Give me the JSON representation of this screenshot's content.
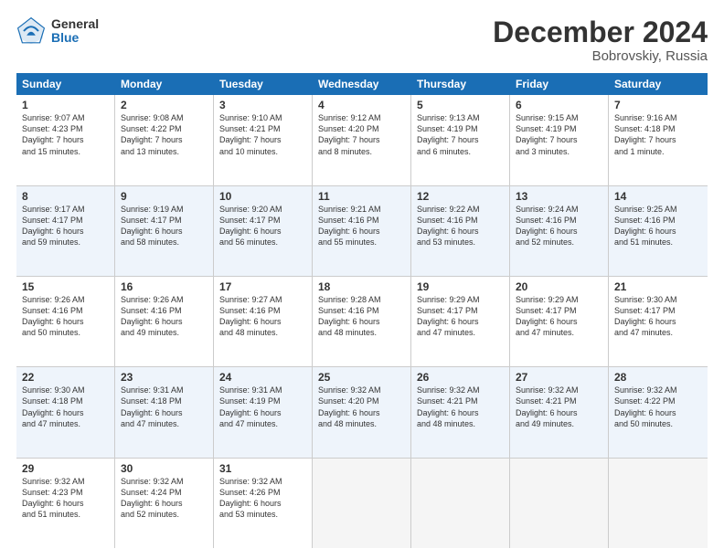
{
  "logo": {
    "general": "General",
    "blue": "Blue"
  },
  "title": "December 2024",
  "location": "Bobrovskiy, Russia",
  "days_of_week": [
    "Sunday",
    "Monday",
    "Tuesday",
    "Wednesday",
    "Thursday",
    "Friday",
    "Saturday"
  ],
  "weeks": [
    [
      {
        "day": "1",
        "info": "Sunrise: 9:07 AM\nSunset: 4:23 PM\nDaylight: 7 hours\nand 15 minutes."
      },
      {
        "day": "2",
        "info": "Sunrise: 9:08 AM\nSunset: 4:22 PM\nDaylight: 7 hours\nand 13 minutes."
      },
      {
        "day": "3",
        "info": "Sunrise: 9:10 AM\nSunset: 4:21 PM\nDaylight: 7 hours\nand 10 minutes."
      },
      {
        "day": "4",
        "info": "Sunrise: 9:12 AM\nSunset: 4:20 PM\nDaylight: 7 hours\nand 8 minutes."
      },
      {
        "day": "5",
        "info": "Sunrise: 9:13 AM\nSunset: 4:19 PM\nDaylight: 7 hours\nand 6 minutes."
      },
      {
        "day": "6",
        "info": "Sunrise: 9:15 AM\nSunset: 4:19 PM\nDaylight: 7 hours\nand 3 minutes."
      },
      {
        "day": "7",
        "info": "Sunrise: 9:16 AM\nSunset: 4:18 PM\nDaylight: 7 hours\nand 1 minute."
      }
    ],
    [
      {
        "day": "8",
        "info": "Sunrise: 9:17 AM\nSunset: 4:17 PM\nDaylight: 6 hours\nand 59 minutes."
      },
      {
        "day": "9",
        "info": "Sunrise: 9:19 AM\nSunset: 4:17 PM\nDaylight: 6 hours\nand 58 minutes."
      },
      {
        "day": "10",
        "info": "Sunrise: 9:20 AM\nSunset: 4:17 PM\nDaylight: 6 hours\nand 56 minutes."
      },
      {
        "day": "11",
        "info": "Sunrise: 9:21 AM\nSunset: 4:16 PM\nDaylight: 6 hours\nand 55 minutes."
      },
      {
        "day": "12",
        "info": "Sunrise: 9:22 AM\nSunset: 4:16 PM\nDaylight: 6 hours\nand 53 minutes."
      },
      {
        "day": "13",
        "info": "Sunrise: 9:24 AM\nSunset: 4:16 PM\nDaylight: 6 hours\nand 52 minutes."
      },
      {
        "day": "14",
        "info": "Sunrise: 9:25 AM\nSunset: 4:16 PM\nDaylight: 6 hours\nand 51 minutes."
      }
    ],
    [
      {
        "day": "15",
        "info": "Sunrise: 9:26 AM\nSunset: 4:16 PM\nDaylight: 6 hours\nand 50 minutes."
      },
      {
        "day": "16",
        "info": "Sunrise: 9:26 AM\nSunset: 4:16 PM\nDaylight: 6 hours\nand 49 minutes."
      },
      {
        "day": "17",
        "info": "Sunrise: 9:27 AM\nSunset: 4:16 PM\nDaylight: 6 hours\nand 48 minutes."
      },
      {
        "day": "18",
        "info": "Sunrise: 9:28 AM\nSunset: 4:16 PM\nDaylight: 6 hours\nand 48 minutes."
      },
      {
        "day": "19",
        "info": "Sunrise: 9:29 AM\nSunset: 4:17 PM\nDaylight: 6 hours\nand 47 minutes."
      },
      {
        "day": "20",
        "info": "Sunrise: 9:29 AM\nSunset: 4:17 PM\nDaylight: 6 hours\nand 47 minutes."
      },
      {
        "day": "21",
        "info": "Sunrise: 9:30 AM\nSunset: 4:17 PM\nDaylight: 6 hours\nand 47 minutes."
      }
    ],
    [
      {
        "day": "22",
        "info": "Sunrise: 9:30 AM\nSunset: 4:18 PM\nDaylight: 6 hours\nand 47 minutes."
      },
      {
        "day": "23",
        "info": "Sunrise: 9:31 AM\nSunset: 4:18 PM\nDaylight: 6 hours\nand 47 minutes."
      },
      {
        "day": "24",
        "info": "Sunrise: 9:31 AM\nSunset: 4:19 PM\nDaylight: 6 hours\nand 47 minutes."
      },
      {
        "day": "25",
        "info": "Sunrise: 9:32 AM\nSunset: 4:20 PM\nDaylight: 6 hours\nand 48 minutes."
      },
      {
        "day": "26",
        "info": "Sunrise: 9:32 AM\nSunset: 4:21 PM\nDaylight: 6 hours\nand 48 minutes."
      },
      {
        "day": "27",
        "info": "Sunrise: 9:32 AM\nSunset: 4:21 PM\nDaylight: 6 hours\nand 49 minutes."
      },
      {
        "day": "28",
        "info": "Sunrise: 9:32 AM\nSunset: 4:22 PM\nDaylight: 6 hours\nand 50 minutes."
      }
    ],
    [
      {
        "day": "29",
        "info": "Sunrise: 9:32 AM\nSunset: 4:23 PM\nDaylight: 6 hours\nand 51 minutes."
      },
      {
        "day": "30",
        "info": "Sunrise: 9:32 AM\nSunset: 4:24 PM\nDaylight: 6 hours\nand 52 minutes."
      },
      {
        "day": "31",
        "info": "Sunrise: 9:32 AM\nSunset: 4:26 PM\nDaylight: 6 hours\nand 53 minutes."
      },
      {
        "day": "",
        "info": ""
      },
      {
        "day": "",
        "info": ""
      },
      {
        "day": "",
        "info": ""
      },
      {
        "day": "",
        "info": ""
      }
    ]
  ]
}
